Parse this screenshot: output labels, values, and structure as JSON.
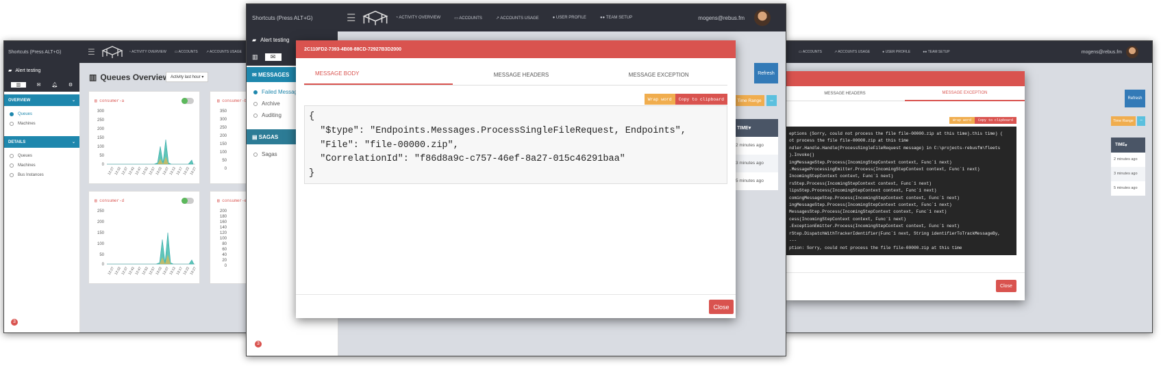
{
  "left": {
    "shortcuts": "Shortcuts (Press ALT+G)",
    "nav": [
      "ACTIVITY OVERVIEW",
      "ACCOUNTS",
      "ACCOUNTS USAGE"
    ],
    "alert": "Alert testing",
    "overview": "OVERVIEW",
    "overview_items": [
      "Queues",
      "Machines"
    ],
    "details": "DETAILS",
    "details_items": [
      "Queues",
      "Machines",
      "Bus Instances"
    ],
    "page_title": "Queues Overview",
    "activity": "Activity last hour",
    "badge": "3",
    "charts": [
      {
        "name": "consumer-a",
        "yticks": [
          "300",
          "250",
          "200",
          "150",
          "100",
          "50",
          "0"
        ],
        "xticks": [
          "12:27",
          "12:32",
          "12:37",
          "12:42",
          "12:47",
          "12:52",
          "12:57",
          "13:02",
          "13:07",
          "13:12",
          "13:17",
          "13:22",
          "13:27"
        ]
      },
      {
        "name": "consumer-b",
        "yticks": [
          "350",
          "300",
          "250",
          "200",
          "150",
          "100",
          "50",
          "0"
        ],
        "xticks": []
      },
      {
        "name": "consumer-d",
        "yticks": [
          "250",
          "200",
          "150",
          "100",
          "50",
          "0"
        ],
        "xticks": [
          "12:27",
          "12:32",
          "12:37",
          "12:42",
          "12:47",
          "12:52",
          "12:57",
          "13:02",
          "13:07",
          "13:12",
          "13:17",
          "13:22",
          "13:27"
        ]
      },
      {
        "name": "consumer-e",
        "yticks": [
          "200",
          "180",
          "160",
          "140",
          "120",
          "100",
          "80",
          "60",
          "40",
          "20",
          "0"
        ],
        "xticks": []
      }
    ]
  },
  "middle": {
    "shortcuts": "Shortcuts (Press ALT+G)",
    "nav": [
      "ACTIVITY OVERVIEW",
      "ACCOUNTS",
      "ACCOUNTS USAGE",
      "USER PROFILE",
      "TEAM SETUP"
    ],
    "user": "mogens@rebus.fm",
    "alert": "Alert testing",
    "messages": "MESSAGES",
    "message_items": [
      "Failed Messag",
      "Archive",
      "Auditing"
    ],
    "sagas": "SAGAS",
    "saga_items": [
      "Sagas"
    ],
    "badge": "3",
    "refresh": "Refresh",
    "time_range": "Time Range",
    "time_col": "TIME",
    "times": [
      "2 minutes ago",
      "3 minutes ago",
      "5 minutes ago"
    ]
  },
  "modal": {
    "title": "2C110FD2-7393-4B08-88CD-72927B3D2000",
    "tabs": [
      "MESSAGE BODY",
      "MESSAGE HEADERS",
      "MESSAGE EXCEPTION"
    ],
    "wrap": "Wrap word",
    "copy": "Copy to clipboard",
    "body": "{\n  \"$type\": \"Endpoints.Messages.ProcessSingleFileRequest, Endpoints\",\n  \"File\": \"file-00000.zip\",\n  \"CorrelationId\": \"f86d8a9c-c757-46ef-8a27-015c46291baa\"\n}",
    "close": "Close"
  },
  "right": {
    "nav": [
      "ACCOUNTS",
      "ACCOUNTS USAGE",
      "USER PROFILE",
      "TEAM SETUP"
    ],
    "user": "mogens@rebus.fm",
    "refresh": "Refresh",
    "time_range": "Time Range",
    "tabs": [
      "MESSAGE HEADERS",
      "MESSAGE EXCEPTION"
    ],
    "wrap": "Wrap word",
    "copy": "Copy to clipboard",
    "time_col": "TIME",
    "times": [
      "2 minutes ago",
      "3 minutes ago",
      "5 minutes ago"
    ],
    "exception": "eptions (Sorry, could not process the file file-00000.zip at this time).this time) (\not process the file file-00000.zip at this time\nndler.Handle.Handle(ProcessSingleFileRequest message) in C:\\projects-rebusfm\\fleets\n).Invoke()\ningMessageStep.Process(IncomingStepContext context, Func`1 next)\n.MessageProcessingEmitter.Process(IncomingStepContext context, Func`1 next)\nIncomingStepContext context, Func`1 next)\nrsStep.Process(IncomingStepContext context, Func`1 next)\nlipsStep.Process(IncomingStepContext context, Func`1 next)\ncomingMessageStep.Process(IncomingStepContext context, Func`1 next)\ningMessageStep.Process(IncomingStepContext context, Func`1 next)\nMessagesStep.Process(IncomingStepContext context, Func`1 next)\ncess(IncomingStepContext context, Func`1 next)\n.ExceptionEmitter.Process(IncomingStepContext context, Func`1 next)\nrStep.DispatchWithTrackerIdentifier(Func`1 next, String identifierToTrackMessageBy,\n---\nption: Sorry, could not process the file file-00000.zip at this time",
    "close": "Close"
  }
}
